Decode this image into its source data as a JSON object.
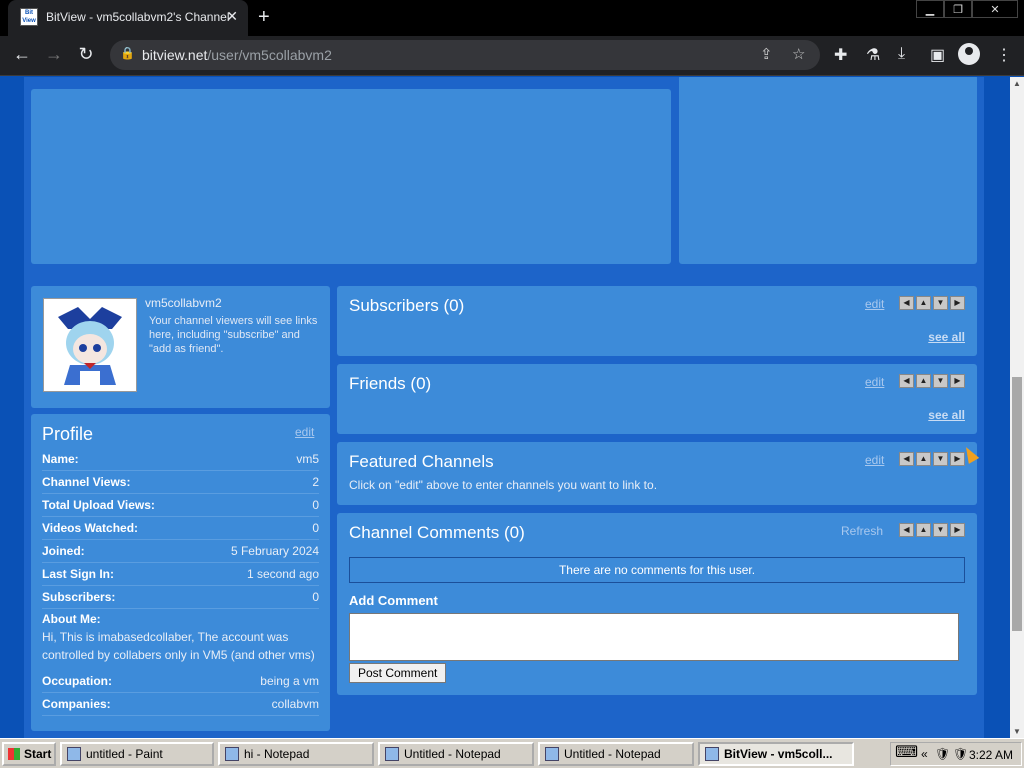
{
  "browser": {
    "tab_title": "BitView - vm5collabvm2's Channel",
    "favicon_text": "Bit View",
    "url_host": "bitview.net",
    "url_path": "/user/vm5collabvm2"
  },
  "channel": {
    "username": "vm5collabvm2",
    "note": "Your channel viewers will see links here, including \"subscribe\" and \"add as friend\"."
  },
  "profile": {
    "title": "Profile",
    "edit": "edit",
    "rows": [
      {
        "k": "Name:",
        "v": "vm5"
      },
      {
        "k": "Channel Views:",
        "v": "2"
      },
      {
        "k": "Total Upload Views:",
        "v": "0"
      },
      {
        "k": "Videos Watched:",
        "v": "0"
      },
      {
        "k": "Joined:",
        "v": "5 February 2024"
      },
      {
        "k": "Last Sign In:",
        "v": "1 second ago"
      },
      {
        "k": "Subscribers:",
        "v": "0"
      }
    ],
    "about_label": "About Me:",
    "about_text": "Hi, This is imabasedcollaber, The account was controlled by collabers only in VM5 (and other vms)",
    "rows2": [
      {
        "k": "Occupation:",
        "v": "being a vm"
      },
      {
        "k": "Companies:",
        "v": "collabvm"
      }
    ]
  },
  "sections": {
    "subscribers": {
      "title": "Subscribers (0)",
      "edit": "edit",
      "see_all": "see all"
    },
    "friends": {
      "title": "Friends (0)",
      "edit": "edit",
      "see_all": "see all"
    },
    "featured": {
      "title": "Featured Channels",
      "edit": "edit",
      "note": "Click on \"edit\" above to enter channels you want to link to."
    },
    "comments": {
      "title": "Channel Comments (0)",
      "refresh": "Refresh",
      "empty": "There are no comments for this user.",
      "add_label": "Add Comment",
      "post_button": "Post Comment"
    }
  },
  "taskbar": {
    "start": "Start",
    "items": [
      "untitled - Paint",
      "hi - Notepad",
      "Untitled - Notepad",
      "Untitled - Notepad",
      "BitView - vm5coll..."
    ],
    "clock": "3:22 AM"
  }
}
